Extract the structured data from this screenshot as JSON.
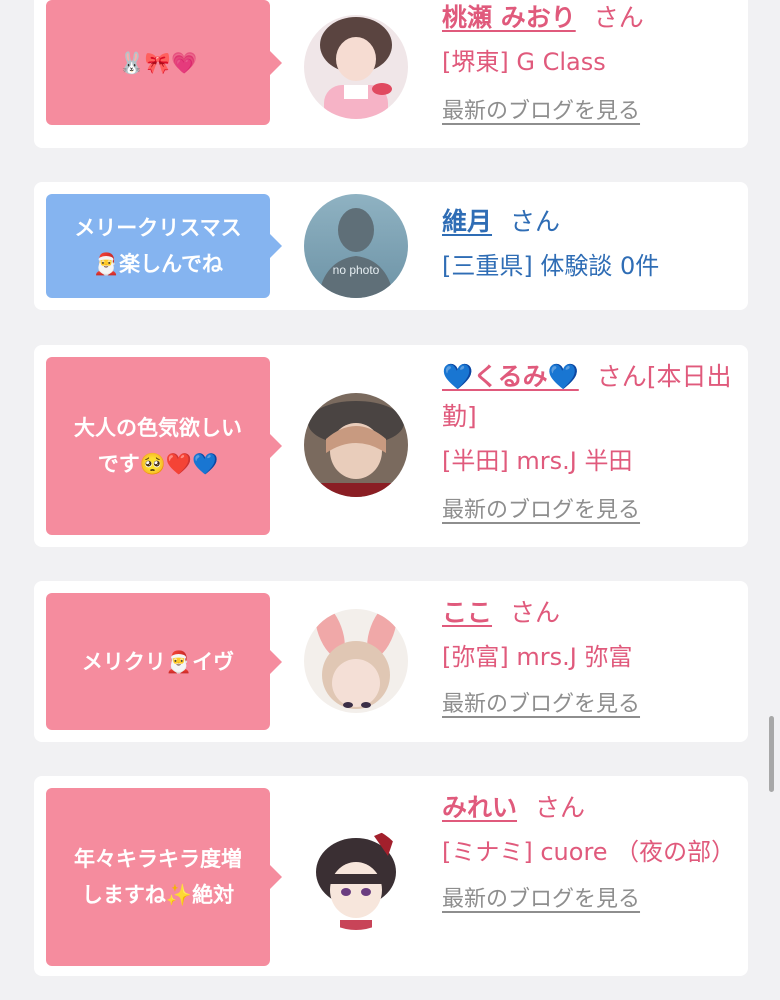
{
  "cards": [
    {
      "message": "🐰🎀💗",
      "name": "桃瀬 みおり",
      "honorific": "さん",
      "shop": "[堺東] G Class",
      "link": "最新のブログを見る",
      "theme": "pink"
    },
    {
      "message": "メリークリスマス\n🎅楽しんでね",
      "name": "維月",
      "honorific": "さん",
      "shop": "[三重県] 体験談 0件",
      "avatar_text": "no photo",
      "theme": "blue"
    },
    {
      "message": "大人の色気欲しい\nです🥺❤️💙",
      "name": "💙くるみ💙",
      "honorific": "さん[本日出勤]",
      "shop": "[半田] mrs.J 半田",
      "link": "最新のブログを見る",
      "theme": "pink"
    },
    {
      "message": "メリクリ🎅イヴ",
      "name": "ここ",
      "honorific": "さん",
      "shop": "[弥富] mrs.J 弥富",
      "link": "最新のブログを見る",
      "theme": "pink"
    },
    {
      "message": "年々キラキラ度増\nしますね✨絶対",
      "name": "みれい",
      "honorific": "さん",
      "shop": "[ミナミ] cuore （夜の部）",
      "link": "最新のブログを見る",
      "theme": "pink"
    }
  ]
}
